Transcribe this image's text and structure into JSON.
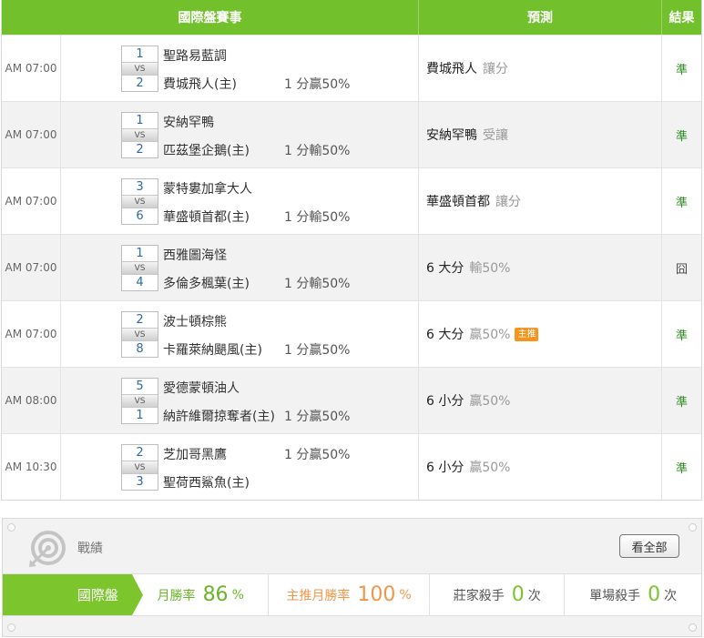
{
  "header": {
    "match": "國際盤賽事",
    "prediction": "預測",
    "result": "結果"
  },
  "vs_label": "VS",
  "games": [
    {
      "time": "AM 07:00",
      "score1": "1",
      "score2": "2",
      "team1": "聖路易藍調",
      "team2": "費城飛人(主)",
      "handicap_row": 2,
      "handicap": "1 分贏50%",
      "pick": "費城飛人",
      "pick_sub": "讓分",
      "tag": "",
      "result": "準"
    },
    {
      "time": "AM 07:00",
      "score1": "1",
      "score2": "2",
      "team1": "安納罕鴨",
      "team2": "匹茲堡企鵝(主)",
      "handicap_row": 2,
      "handicap": "1 分輸50%",
      "pick": "安納罕鴨",
      "pick_sub": "受讓",
      "tag": "",
      "result": "準"
    },
    {
      "time": "AM 07:00",
      "score1": "3",
      "score2": "6",
      "team1": "蒙特婁加拿大人",
      "team2": "華盛頓首都(主)",
      "handicap_row": 2,
      "handicap": "1 分輸50%",
      "pick": "華盛頓首都",
      "pick_sub": "讓分",
      "tag": "",
      "result": "準"
    },
    {
      "time": "AM 07:00",
      "score1": "1",
      "score2": "4",
      "team1": "西雅圖海怪",
      "team2": "多倫多楓葉(主)",
      "handicap_row": 2,
      "handicap": "1 分輸50%",
      "pick": "6 大分",
      "pick_sub": "輸50%",
      "tag": "",
      "result": "囧"
    },
    {
      "time": "AM 07:00",
      "score1": "2",
      "score2": "8",
      "team1": "波士頓棕熊",
      "team2": "卡羅萊納颶風(主)",
      "handicap_row": 2,
      "handicap": "1 分贏50%",
      "pick": "6 大分",
      "pick_sub": "贏50%",
      "tag": "主推",
      "result": "準"
    },
    {
      "time": "AM 08:00",
      "score1": "5",
      "score2": "1",
      "team1": "愛德蒙頓油人",
      "team2": "納許維爾掠奪者(主)",
      "handicap_row": 2,
      "handicap": "1 分贏50%",
      "pick": "6 小分",
      "pick_sub": "贏50%",
      "tag": "",
      "result": "準"
    },
    {
      "time": "AM 10:30",
      "score1": "2",
      "score2": "3",
      "team1": "芝加哥黑鷹",
      "team2": "聖荷西鯊魚(主)",
      "handicap_row": 1,
      "handicap": "1 分贏50%",
      "pick": "6 小分",
      "pick_sub": "贏50%",
      "tag": "",
      "result": "準"
    }
  ],
  "stats_panel": {
    "title": "戰績",
    "view_all": "看全部",
    "category": "國際盤",
    "monthly_win_label": "月勝率",
    "monthly_win_value": "86",
    "monthly_win_unit": "%",
    "top_pick_label": "主推月勝率",
    "top_pick_value": "100",
    "top_pick_unit": "%",
    "bookie_killer_label": "莊家殺手",
    "bookie_killer_value": "0",
    "bookie_killer_unit": "次",
    "single_killer_label": "單場殺手",
    "single_killer_value": "0",
    "single_killer_unit": "次",
    "colors": {
      "green": "#7cc52c",
      "orange": "#f0964a",
      "header_green": "#72c02c"
    }
  }
}
